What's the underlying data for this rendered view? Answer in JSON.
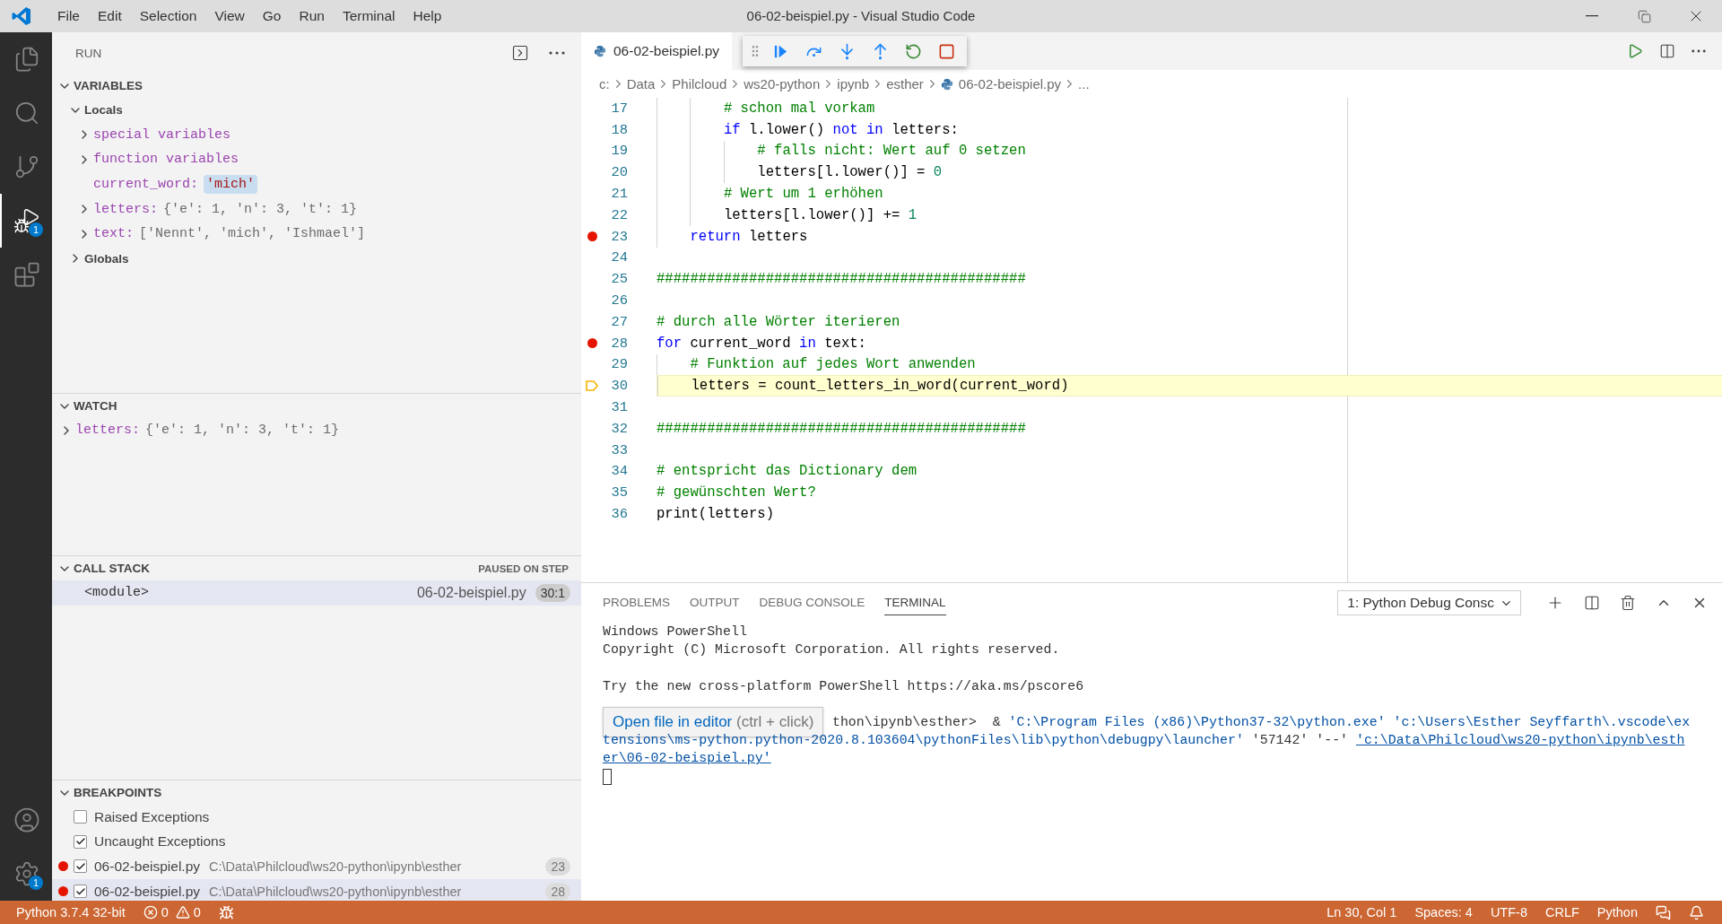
{
  "window": {
    "title": "06-02-beispiel.py - Visual Studio Code"
  },
  "menu": [
    "File",
    "Edit",
    "Selection",
    "View",
    "Go",
    "Run",
    "Terminal",
    "Help"
  ],
  "activity_bar": {
    "items": [
      {
        "kind": "files",
        "selected": false
      },
      {
        "kind": "search",
        "selected": false
      },
      {
        "kind": "scm",
        "selected": false
      },
      {
        "kind": "debug",
        "selected": true,
        "badge": "1"
      },
      {
        "kind": "extensions",
        "selected": false
      }
    ],
    "bottom": [
      {
        "kind": "account"
      },
      {
        "kind": "settings",
        "badge": "1"
      }
    ]
  },
  "sidebar": {
    "title": "RUN"
  },
  "variables": {
    "title": "VARIABLES",
    "expanded": true,
    "scopes": [
      {
        "label": "Locals",
        "expanded": true,
        "children": [
          {
            "name": "special variables",
            "expanded": false
          },
          {
            "name": "function variables",
            "expanded": false
          },
          {
            "name": "current_word:",
            "value": "'mich'",
            "highlighted": true
          },
          {
            "name": "letters:",
            "value": "{'e': 1, 'n': 3, 't': 1}",
            "expanded": false
          },
          {
            "name": "text:",
            "value": "['Nennt', 'mich', 'Ishmael']",
            "expanded": false
          }
        ]
      },
      {
        "label": "Globals",
        "expanded": false
      }
    ]
  },
  "watch": {
    "title": "WATCH",
    "expanded": true,
    "items": [
      {
        "name": "letters:",
        "value": "{'e': 1, 'n': 3, 't': 1}",
        "expanded": false
      }
    ]
  },
  "call_stack": {
    "title": "CALL STACK",
    "expanded": true,
    "status": "PAUSED ON STEP",
    "frames": [
      {
        "name": "<module>",
        "file": "06-02-beispiel.py",
        "position": "30:1",
        "selected": true
      }
    ]
  },
  "breakpoints": {
    "title": "BREAKPOINTS",
    "expanded": true,
    "items": [
      {
        "kind": "exception",
        "label": "Raised Exceptions",
        "checked": false,
        "selected": false
      },
      {
        "kind": "exception",
        "label": "Uncaught Exceptions",
        "checked": true,
        "selected": false
      },
      {
        "kind": "line",
        "label": "06-02-beispiel.py",
        "path": "C:\\Data\\Philcloud\\ws20-python\\ipynb\\esther",
        "line": "23",
        "checked": true,
        "selected": false
      },
      {
        "kind": "line",
        "label": "06-02-beispiel.py",
        "path": "C:\\Data\\Philcloud\\ws20-python\\ipynb\\esther",
        "line": "28",
        "checked": true,
        "selected": true
      }
    ]
  },
  "editor": {
    "tab": {
      "label": "06-02-beispiel.py"
    },
    "debug_toolbar": [
      {
        "kind": "continue"
      },
      {
        "kind": "step_over"
      },
      {
        "kind": "step_into"
      },
      {
        "kind": "step_out"
      },
      {
        "kind": "restart"
      },
      {
        "kind": "stop"
      }
    ],
    "breadcrumbs": [
      {
        "label": "c:",
        "kind": "folder"
      },
      {
        "label": "Data",
        "kind": "folder"
      },
      {
        "label": "Philcloud",
        "kind": "folder"
      },
      {
        "label": "ws20-python",
        "kind": "folder"
      },
      {
        "label": "ipynb",
        "kind": "folder"
      },
      {
        "label": "esther",
        "kind": "folder"
      },
      {
        "label": "06-02-beispiel.py",
        "kind": "file"
      },
      {
        "label": "...",
        "kind": "more"
      }
    ],
    "lines": [
      {
        "number": "17",
        "breakpoint": false,
        "current": false,
        "tokens": [
          {
            "text": "        # schon mal vorkam",
            "kind": "comment"
          }
        ]
      },
      {
        "number": "18",
        "breakpoint": false,
        "current": false,
        "tokens": [
          {
            "text": "        if",
            "kind": "keyword"
          },
          {
            "text": " l.lower() ",
            "kind": "plain"
          },
          {
            "text": "not in",
            "kind": "keyword"
          },
          {
            "text": " letters:",
            "kind": "plain"
          }
        ]
      },
      {
        "number": "19",
        "breakpoint": false,
        "current": false,
        "tokens": [
          {
            "text": "            # falls nicht: Wert auf 0 setzen",
            "kind": "comment"
          }
        ]
      },
      {
        "number": "20",
        "breakpoint": false,
        "current": false,
        "tokens": [
          {
            "text": "            letters[l.lower()] = ",
            "kind": "plain"
          },
          {
            "text": "0",
            "kind": "number"
          }
        ]
      },
      {
        "number": "21",
        "breakpoint": false,
        "current": false,
        "tokens": [
          {
            "text": "        # Wert um 1 erhöhen",
            "kind": "comment"
          }
        ]
      },
      {
        "number": "22",
        "breakpoint": false,
        "current": false,
        "tokens": [
          {
            "text": "        letters[l.lower()] += ",
            "kind": "plain"
          },
          {
            "text": "1",
            "kind": "number"
          }
        ]
      },
      {
        "number": "23",
        "breakpoint": true,
        "current": false,
        "tokens": [
          {
            "text": "    return",
            "kind": "keyword"
          },
          {
            "text": " letters",
            "kind": "plain"
          }
        ]
      },
      {
        "number": "24",
        "breakpoint": false,
        "current": false
      },
      {
        "number": "25",
        "breakpoint": false,
        "current": false,
        "tokens": [
          {
            "text": "############################################",
            "kind": "comment"
          }
        ]
      },
      {
        "number": "26",
        "breakpoint": false,
        "current": false
      },
      {
        "number": "27",
        "breakpoint": false,
        "current": false,
        "tokens": [
          {
            "text": "# durch alle Wörter iterieren",
            "kind": "comment"
          }
        ]
      },
      {
        "number": "28",
        "breakpoint": true,
        "current": false,
        "tokens": [
          {
            "text": "for",
            "kind": "keyword"
          },
          {
            "text": " current_word ",
            "kind": "plain"
          },
          {
            "text": "in",
            "kind": "keyword"
          },
          {
            "text": " text:",
            "kind": "plain"
          }
        ]
      },
      {
        "number": "29",
        "breakpoint": false,
        "current": false,
        "tokens": [
          {
            "text": "    # Funktion auf jedes Wort anwenden",
            "kind": "comment"
          }
        ]
      },
      {
        "number": "30",
        "breakpoint": false,
        "current": true,
        "tokens": [
          {
            "text": "    letters = count_letters_in_word(current_word)",
            "kind": "plain"
          }
        ]
      },
      {
        "number": "31",
        "breakpoint": false,
        "current": false
      },
      {
        "number": "32",
        "breakpoint": false,
        "current": false,
        "tokens": [
          {
            "text": "############################################",
            "kind": "comment"
          }
        ]
      },
      {
        "number": "33",
        "breakpoint": false,
        "current": false
      },
      {
        "number": "34",
        "breakpoint": false,
        "current": false,
        "tokens": [
          {
            "text": "# entspricht das Dictionary dem",
            "kind": "comment"
          }
        ]
      },
      {
        "number": "35",
        "breakpoint": false,
        "current": false,
        "tokens": [
          {
            "text": "# gewünschten Wert?",
            "kind": "comment"
          }
        ]
      },
      {
        "number": "36",
        "breakpoint": false,
        "current": false,
        "tokens": [
          {
            "text": "print(letters)",
            "kind": "plain"
          }
        ]
      }
    ]
  },
  "panel": {
    "tabs": [
      {
        "label": "PROBLEMS",
        "selected": false
      },
      {
        "label": "OUTPUT",
        "selected": false
      },
      {
        "label": "DEBUG CONSOLE",
        "selected": false
      },
      {
        "label": "TERMINAL",
        "selected": true
      }
    ],
    "terminal_select": "1: Python Debug Consc",
    "tooltip": {
      "label": "Open file in editor",
      "hint": "(ctrl + click)"
    },
    "terminal": [
      {
        "kind": "text",
        "segments": [
          {
            "text": "Windows PowerShell",
            "kind": "plain"
          }
        ]
      },
      {
        "kind": "text",
        "segments": [
          {
            "text": "Copyright (C) Microsoft Corporation. All rights reserved.",
            "kind": "plain"
          }
        ]
      },
      {
        "kind": "blank"
      },
      {
        "kind": "text",
        "segments": [
          {
            "text": "Try the new cross-platform PowerShell https://aka.ms/pscore6",
            "kind": "plain"
          }
        ]
      },
      {
        "kind": "blank"
      },
      {
        "kind": "covered",
        "segments": [
          {
            "text": "thon\\ipynb\\esther>  & ",
            "kind": "plain"
          },
          {
            "text": "'C:\\Program Files (x86)\\Python37-32\\python.exe' 'c:\\Users\\Esther Seyffarth\\.vscode\\ex",
            "kind": "string"
          }
        ]
      },
      {
        "kind": "text",
        "segments": [
          {
            "text": "tensions\\ms-python.python-2020.8.103604\\pythonFiles\\lib\\python\\debugpy\\launcher'",
            "kind": "string"
          },
          {
            "text": " '57142' '--' ",
            "kind": "plain"
          },
          {
            "text": "'c:\\Data\\Philcloud\\ws20-python\\ipynb\\esth",
            "kind": "link"
          }
        ]
      },
      {
        "kind": "text",
        "segments": [
          {
            "text": "er\\06-02-beispiel.py'",
            "kind": "link"
          }
        ]
      }
    ]
  },
  "status_bar": {
    "interpreter": "Python 3.7.4 32-bit",
    "errors": "0",
    "warnings": "0",
    "right": [
      "Ln 30, Col 1",
      "Spaces: 4",
      "UTF-8",
      "CRLF",
      "Python"
    ]
  }
}
